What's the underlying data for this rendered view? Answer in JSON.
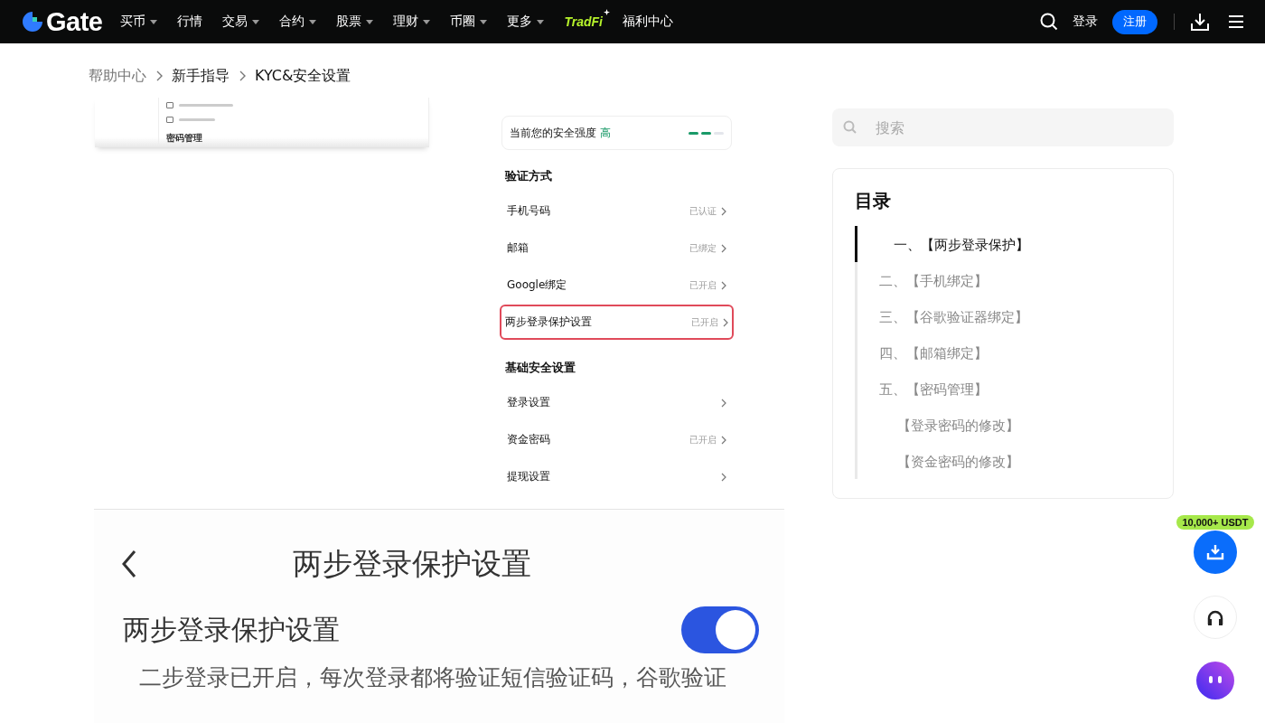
{
  "nav": {
    "logo": "Gate",
    "items": [
      {
        "label": "买币",
        "dropdown": true
      },
      {
        "label": "行情",
        "dropdown": false
      },
      {
        "label": "交易",
        "dropdown": true
      },
      {
        "label": "合约",
        "dropdown": true
      },
      {
        "label": "股票",
        "dropdown": true
      },
      {
        "label": "理财",
        "dropdown": true
      },
      {
        "label": "币圈",
        "dropdown": true
      },
      {
        "label": "更多",
        "dropdown": true
      }
    ],
    "tradfi": "TradFi",
    "rewards": "福利中心",
    "login": "登录",
    "register": "注册"
  },
  "breadcrumb": [
    "帮助中心",
    "新手指导",
    "KYC&安全设置"
  ],
  "article": {
    "fragment": {
      "heading": "密码管理"
    },
    "phone": {
      "strength_label": "当前您的安全强度",
      "strength_value": "高",
      "level": 0.67,
      "sections": [
        {
          "title": "验证方式",
          "rows": [
            {
              "label": "手机号码",
              "status": "已认证",
              "highlighted": false
            },
            {
              "label": "邮箱",
              "status": "已绑定",
              "highlighted": false
            },
            {
              "label": "Google绑定",
              "status": "已开启",
              "highlighted": false
            },
            {
              "label": "两步登录保护设置",
              "status": "已开启",
              "highlighted": true
            }
          ]
        },
        {
          "title": "基础安全设置",
          "rows": [
            {
              "label": "登录设置",
              "highlighted": false
            },
            {
              "label": "资金密码",
              "status": "已开启",
              "highlighted": false
            },
            {
              "label": "提现设置",
              "highlighted": false
            }
          ]
        }
      ]
    },
    "detail": {
      "title": "两步登录保护设置",
      "setting": "两步登录保护设置",
      "on": true,
      "description": "二步登录已开启，每次登录都将验证短信验证码，谷歌验证"
    }
  },
  "search": {
    "placeholder": "搜索"
  },
  "toc": {
    "title": "目录",
    "items": [
      {
        "label": "一、【两步登录保护】",
        "selected": true
      },
      {
        "label": "二、【手机绑定】",
        "selected": false
      },
      {
        "label": "三、【谷歌验证器绑定】",
        "selected": false
      },
      {
        "label": "四、【邮箱绑定】",
        "selected": false
      },
      {
        "label": "五、【密码管理】",
        "selected": false,
        "children": [
          {
            "label": "【登录密码的修改】",
            "selected": false
          },
          {
            "label": "【资金密码的修改】",
            "selected": false
          }
        ]
      }
    ]
  },
  "floating": {
    "badge": "10,000+ USDT"
  }
}
